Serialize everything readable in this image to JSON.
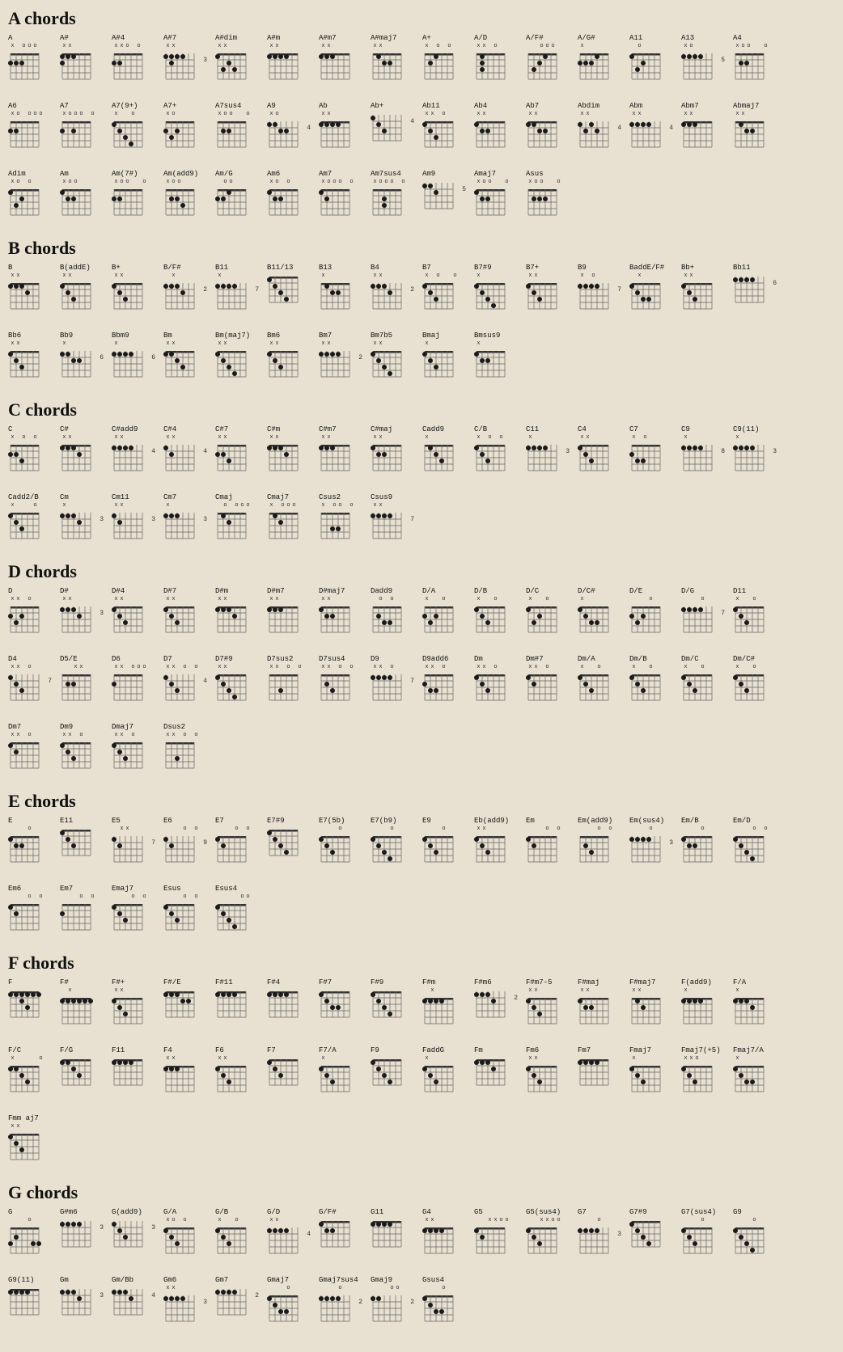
{
  "sections": [
    {
      "id": "A",
      "title": "A chords",
      "chords": [
        {
          "name": "A",
          "open": "x oo o",
          "fret": "",
          "dots": [
            [
              2,
              1
            ],
            [
              2,
              2
            ],
            [
              2,
              3
            ]
          ]
        },
        {
          "name": "A#",
          "open": "x x o o",
          "fret": "",
          "dots": [
            [
              1,
              1
            ],
            [
              1,
              2
            ]
          ]
        },
        {
          "name": "A#4",
          "open": "x x o o",
          "fret": "",
          "dots": [
            [
              1,
              1
            ],
            [
              2,
              2
            ],
            [
              3,
              3
            ]
          ]
        },
        {
          "name": "A#7",
          "open": "",
          "fret": "3",
          "dots": [
            [
              1,
              1
            ],
            [
              2,
              2
            ],
            [
              3,
              3
            ],
            [
              4,
              4
            ]
          ]
        },
        {
          "name": "A#dim",
          "open": "x x o o",
          "fret": "",
          "dots": [
            [
              1,
              1
            ],
            [
              2,
              2
            ]
          ]
        },
        {
          "name": "A#m",
          "open": "x x",
          "fret": "",
          "dots": [
            [
              1,
              1
            ],
            [
              2,
              2
            ],
            [
              3,
              3
            ]
          ]
        },
        {
          "name": "A#m7",
          "open": "x x",
          "fret": "",
          "dots": [
            [
              1,
              1
            ],
            [
              2,
              2
            ],
            [
              3,
              3
            ]
          ]
        },
        {
          "name": "A#maj7",
          "open": "x x",
          "fret": "",
          "dots": [
            [
              1,
              1
            ],
            [
              2,
              2
            ]
          ]
        },
        {
          "name": "A+",
          "open": "x o o o",
          "fret": "",
          "dots": [
            [
              1,
              1
            ],
            [
              2,
              2
            ]
          ]
        },
        {
          "name": "A/D",
          "open": "x x o",
          "fret": "",
          "dots": [
            [
              2,
              1
            ],
            [
              2,
              2
            ],
            [
              2,
              3
            ]
          ]
        },
        {
          "name": "A/F#",
          "open": "",
          "fret": "",
          "dots": [
            [
              1,
              1
            ],
            [
              2,
              2
            ],
            [
              2,
              3
            ],
            [
              2,
              4
            ]
          ]
        },
        {
          "name": "A/G#",
          "open": "x",
          "fret": "",
          "dots": [
            [
              1,
              1
            ],
            [
              2,
              2
            ],
            [
              2,
              3
            ]
          ]
        },
        {
          "name": "A11",
          "open": "",
          "fret": "",
          "dots": [
            [
              1,
              1
            ],
            [
              2,
              2
            ],
            [
              3,
              3
            ]
          ]
        },
        {
          "name": "A13",
          "open": "",
          "fret": "5",
          "dots": [
            [
              1,
              1
            ],
            [
              2,
              2
            ]
          ]
        },
        {
          "name": "A4",
          "open": "x o o",
          "fret": "",
          "dots": [
            [
              2,
              1
            ],
            [
              2,
              2
            ],
            [
              3,
              3
            ]
          ]
        }
      ]
    },
    {
      "id": "A2",
      "title": "",
      "chords": [
        {
          "name": "A6",
          "open": "x o o o",
          "fret": "",
          "dots": [
            [
              1,
              1
            ],
            [
              2,
              2
            ]
          ]
        },
        {
          "name": "A7",
          "open": "x o o o",
          "fret": "",
          "dots": [
            [
              1,
              1
            ],
            [
              2,
              2
            ],
            [
              3,
              3
            ]
          ]
        },
        {
          "name": "A7(9+)",
          "open": "x o",
          "fret": "",
          "dots": [
            [
              1,
              1
            ],
            [
              2,
              2
            ],
            [
              3,
              3
            ],
            [
              4,
              4
            ]
          ]
        },
        {
          "name": "A7+",
          "open": "x o",
          "fret": "",
          "dots": [
            [
              1,
              1
            ],
            [
              2,
              2
            ],
            [
              3,
              3
            ]
          ]
        },
        {
          "name": "A7sus4",
          "open": "x o o",
          "fret": "",
          "dots": [
            [
              2,
              1
            ],
            [
              3,
              2
            ]
          ]
        },
        {
          "name": "A9",
          "open": "x o",
          "fret": "4",
          "dots": [
            [
              1,
              1
            ],
            [
              2,
              2
            ],
            [
              3,
              3
            ]
          ]
        },
        {
          "name": "Ab",
          "open": "x x",
          "fret": "",
          "dots": [
            [
              1,
              1
            ],
            [
              2,
              2
            ],
            [
              3,
              3
            ]
          ]
        },
        {
          "name": "Ab+",
          "open": "",
          "fret": "4",
          "dots": [
            [
              1,
              1
            ],
            [
              2,
              2
            ],
            [
              3,
              3
            ]
          ]
        },
        {
          "name": "Ab11",
          "open": "x x o",
          "fret": "",
          "dots": [
            [
              1,
              1
            ],
            [
              2,
              2
            ],
            [
              3,
              3
            ]
          ]
        },
        {
          "name": "Ab4",
          "open": "x x",
          "fret": "",
          "dots": [
            [
              1,
              1
            ],
            [
              2,
              2
            ],
            [
              3,
              3
            ]
          ]
        },
        {
          "name": "Ab7",
          "open": "x x",
          "fret": "",
          "dots": [
            [
              1,
              1
            ],
            [
              2,
              2
            ],
            [
              3,
              3
            ]
          ]
        },
        {
          "name": "Abdim",
          "open": "x x",
          "fret": "4",
          "dots": [
            [
              1,
              1
            ],
            [
              2,
              2
            ]
          ]
        },
        {
          "name": "Abm",
          "open": "x x",
          "fret": "4",
          "dots": [
            [
              1,
              1
            ],
            [
              2,
              2
            ],
            [
              3,
              3
            ]
          ]
        },
        {
          "name": "Abm7",
          "open": "x x",
          "fret": "",
          "dots": [
            [
              1,
              1
            ],
            [
              2,
              2
            ],
            [
              3,
              3
            ]
          ]
        },
        {
          "name": "Abmaj7",
          "open": "x x",
          "fret": "",
          "dots": [
            [
              1,
              1
            ],
            [
              2,
              2
            ]
          ]
        }
      ]
    },
    {
      "id": "A3",
      "title": "",
      "chords": [
        {
          "name": "Adim",
          "open": "x o o",
          "fret": "",
          "dots": [
            [
              1,
              1
            ],
            [
              2,
              2
            ],
            [
              3,
              3
            ]
          ]
        },
        {
          "name": "Am",
          "open": "x o o",
          "fret": "",
          "dots": [
            [
              1,
              1
            ],
            [
              2,
              2
            ],
            [
              2,
              3
            ]
          ]
        },
        {
          "name": "Am(7#)",
          "open": "x o o",
          "fret": "",
          "dots": [
            [
              1,
              1
            ],
            [
              2,
              2
            ]
          ]
        },
        {
          "name": "Am(add9)",
          "open": "x o o",
          "fret": "",
          "dots": [
            [
              2,
              1
            ],
            [
              2,
              2
            ],
            [
              3,
              3
            ]
          ]
        },
        {
          "name": "Am/G",
          "open": "",
          "fret": "",
          "dots": [
            [
              2,
              1
            ],
            [
              2,
              2
            ],
            [
              2,
              3
            ]
          ]
        },
        {
          "name": "Am6",
          "open": "x o",
          "fret": "",
          "dots": [
            [
              1,
              1
            ],
            [
              2,
              2
            ],
            [
              2,
              3
            ]
          ]
        },
        {
          "name": "Am7",
          "open": "x o o o",
          "fret": "",
          "dots": [
            [
              1,
              1
            ],
            [
              2,
              2
            ]
          ]
        },
        {
          "name": "Am7sus4",
          "open": "x o o o",
          "fret": "",
          "dots": [
            [
              3,
              1
            ],
            [
              3,
              2
            ]
          ]
        },
        {
          "name": "Am9",
          "open": "",
          "fret": "5",
          "dots": [
            [
              1,
              1
            ],
            [
              2,
              2
            ],
            [
              3,
              3
            ]
          ]
        },
        {
          "name": "Amaj7",
          "open": "x o o",
          "fret": "",
          "dots": [
            [
              1,
              1
            ],
            [
              2,
              2
            ],
            [
              2,
              3
            ]
          ]
        },
        {
          "name": "Asus",
          "open": "x o o",
          "fret": "",
          "dots": [
            [
              2,
              1
            ],
            [
              2,
              2
            ],
            [
              2,
              3
            ],
            [
              3,
              4
            ]
          ]
        }
      ]
    }
  ],
  "page_title": "chords"
}
